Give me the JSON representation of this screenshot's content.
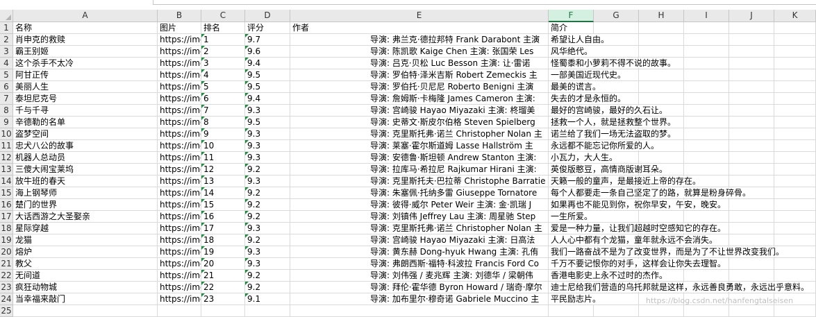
{
  "columns": [
    "A",
    "B",
    "C",
    "D",
    "E",
    "F",
    "G",
    "H",
    "I",
    "J",
    "K"
  ],
  "selected_column": "F",
  "header_row": {
    "name": "名称",
    "pic": "图片",
    "rank": "排名",
    "score": "评分",
    "author": "作者",
    "intro": "简介"
  },
  "rows": [
    {
      "n": "2",
      "name": "肖申克的救赎",
      "pic": "https://img",
      "rank": "1",
      "score": "9.7",
      "author": "导演: 弗兰克·德拉邦特 Frank Darabont   主演",
      "intro": "希望让人自由。"
    },
    {
      "n": "3",
      "name": "霸王别姬",
      "pic": "https://img",
      "rank": "2",
      "score": "9.6",
      "author": "导演: 陈凯歌 Kaige Chen   主演: 张国荣 Les",
      "intro": "风华绝代。"
    },
    {
      "n": "4",
      "name": "这个杀手不太冷",
      "pic": "https://img",
      "rank": "3",
      "score": "9.4",
      "author": "导演: 吕克·贝松 Luc Besson   主演: 让·雷诺",
      "intro": "怪蜀黍和小萝莉不得不说的故事。"
    },
    {
      "n": "5",
      "name": "阿甘正传",
      "pic": "https://img",
      "rank": "4",
      "score": "9.5",
      "author": "导演: 罗伯特·泽米吉斯 Robert Zemeckis   主",
      "intro": "一部美国近现代史。"
    },
    {
      "n": "6",
      "name": "美丽人生",
      "pic": "https://img",
      "rank": "5",
      "score": "9.5",
      "author": "导演: 罗伯托·贝尼尼 Roberto Benigni   主演",
      "intro": "最美的谎言。"
    },
    {
      "n": "7",
      "name": "泰坦尼克号",
      "pic": "https://img",
      "rank": "6",
      "score": "9.4",
      "author": "导演: 詹姆斯·卡梅隆 James Cameron   主演:",
      "intro": "失去的才是永恒的。"
    },
    {
      "n": "8",
      "name": "千与千寻",
      "pic": "https://img",
      "rank": "7",
      "score": "9.3",
      "author": "导演: 宫崎骏 Hayao Miyazaki   主演: 柊瑠美",
      "intro": "最好的宫崎骏，最好的久石让。"
    },
    {
      "n": "9",
      "name": "辛德勒的名单",
      "pic": "https://img",
      "rank": "8",
      "score": "9.5",
      "author": "导演: 史蒂文·斯皮尔伯格 Steven Spielberg",
      "intro": "拯救一个人，就是拯救整个世界。"
    },
    {
      "n": "10",
      "name": "盗梦空间",
      "pic": "https://img",
      "rank": "9",
      "score": "9.3",
      "author": "导演: 克里斯托弗·诺兰 Christopher Nolan   主",
      "intro": "诺兰给了我们一场无法盗取的梦。"
    },
    {
      "n": "11",
      "name": "忠犬八公的故事",
      "pic": "https://img",
      "rank": "10",
      "score": "9.3",
      "author": "导演: 莱塞·霍尔斯道姆 Lasse Hallström   主",
      "intro": "永远都不能忘记你所爱的人。"
    },
    {
      "n": "12",
      "name": "机器人总动员",
      "pic": "https://img",
      "rank": "11",
      "score": "9.3",
      "author": "导演: 安德鲁·斯坦顿 Andrew Stanton   主演:",
      "intro": "小瓦力，大人生。"
    },
    {
      "n": "13",
      "name": "三傻大闹宝莱坞",
      "pic": "https://img",
      "rank": "12",
      "score": "9.2",
      "author": "导演: 拉库马·希拉尼 Rajkumar Hirani   主演:",
      "intro": "英俊版憨豆，高情商版谢耳朵。"
    },
    {
      "n": "14",
      "name": "放牛班的春天",
      "pic": "https://img",
      "rank": "13",
      "score": "9.3",
      "author": "导演: 克里斯托夫·巴拉蒂 Christophe Barratie",
      "intro": "天籁一般的童声，是最接近上帝的存在。"
    },
    {
      "n": "15",
      "name": "海上钢琴师",
      "pic": "https://img",
      "rank": "14",
      "score": "9.2",
      "author": "导演: 朱塞佩·托纳多雷 Giuseppe Tornatore",
      "intro": "每个人都要走一条自己坚定了的路，就算是粉身碎骨。"
    },
    {
      "n": "16",
      "name": "楚门的世界",
      "pic": "https://img",
      "rank": "15",
      "score": "9.2",
      "author": "导演: 彼得·威尔 Peter Weir   主演: 金·凯瑞 J",
      "intro": "如果再也不能见到你，祝你早安，午安，晚安。"
    },
    {
      "n": "17",
      "name": "大话西游之大圣娶亲",
      "pic": "https://img",
      "rank": "16",
      "score": "9.2",
      "author": "导演: 刘镇伟 Jeffrey Lau   主演: 周星驰 Step",
      "intro": "一生所爱。"
    },
    {
      "n": "18",
      "name": "星际穿越",
      "pic": "https://img",
      "rank": "17",
      "score": "9.3",
      "author": "导演: 克里斯托弗·诺兰 Christopher Nolan   主",
      "intro": "爱是一种力量，让我们超越时空感知它的存在。"
    },
    {
      "n": "19",
      "name": "龙猫",
      "pic": "https://img",
      "rank": "18",
      "score": "9.2",
      "author": "导演: 宫崎骏 Hayao Miyazaki   主演: 日高法",
      "intro": "人人心中都有个龙猫，童年就永远不会消失。"
    },
    {
      "n": "20",
      "name": "熔炉",
      "pic": "https://img",
      "rank": "19",
      "score": "9.3",
      "author": "导演: 黄东赫 Dong-hyuk Hwang   主演: 孔侑",
      "intro": "我们一路奋战不是为了改变世界，而是为了不让世界改变我们。"
    },
    {
      "n": "21",
      "name": "教父",
      "pic": "https://img",
      "rank": "20",
      "score": "9.3",
      "author": "导演: 弗朗西斯·福特·科波拉 Francis Ford Co",
      "intro": "千万不要记恨你的对手，这样会让你失去理智。"
    },
    {
      "n": "22",
      "name": "无间道",
      "pic": "https://img",
      "rank": "21",
      "score": "9.2",
      "author": "导演: 刘伟强 / 麦兆辉   主演: 刘德华 / 梁朝伟",
      "intro": "香港电影史上永不过时的杰作。"
    },
    {
      "n": "23",
      "name": "疯狂动物城",
      "pic": "https://img",
      "rank": "22",
      "score": "9.2",
      "author": "导演: 拜伦·霍华德 Byron Howard / 瑞奇·摩尔",
      "intro": "迪士尼给我们营造的乌托邦就是这样，永远善良勇敢，永远出乎意料。"
    },
    {
      "n": "24",
      "name": "当幸福来敲门",
      "pic": "https://img",
      "rank": "23",
      "score": "9.1",
      "author": "导演: 加布里尔·穆奇诺 Gabriele Muccino   主",
      "intro": "平民励志片。"
    }
  ],
  "watermark": "https://blog.csdn.net/hanfengtalseisen"
}
